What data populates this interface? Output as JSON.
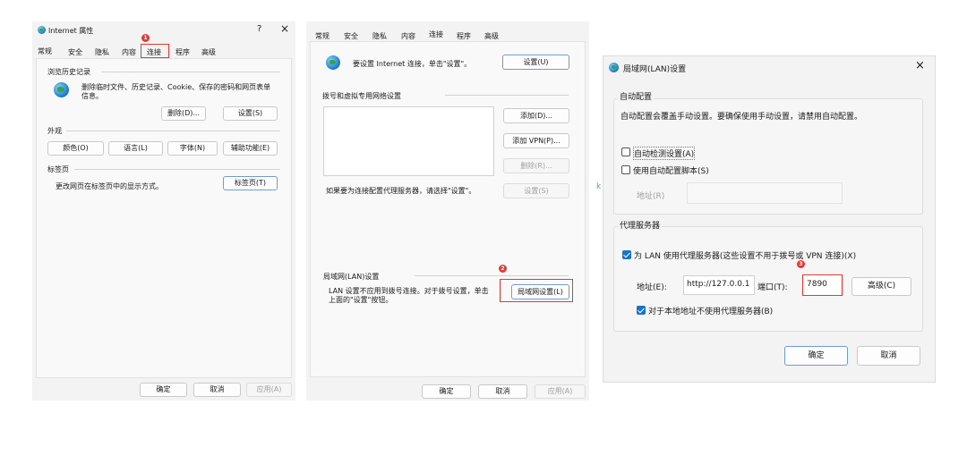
{
  "d1": {
    "title": "Internet 属性",
    "help": "?",
    "close": "×",
    "tabs": [
      "常规",
      "安全",
      "隐私",
      "内容",
      "连接",
      "程序",
      "高级"
    ],
    "history": {
      "heading": "浏览历史记录",
      "desc": "删除临时文件、历史记录、Cookie、保存的密码和网页表单信息。",
      "delete_btn": "删除(D)...",
      "settings_btn": "设置(S)"
    },
    "appearance": {
      "heading": "外观",
      "buttons": [
        "颜色(O)",
        "语言(L)",
        "字体(N)",
        "辅助功能(E)"
      ]
    },
    "tabs_section": {
      "heading": "标签页",
      "desc": "更改网页在标签页中的显示方式。",
      "btn": "标签页(T)"
    },
    "ok": "确定",
    "cancel": "取消",
    "apply": "应用(A)",
    "badge": "1"
  },
  "d2": {
    "tabs": [
      "常规",
      "安全",
      "隐私",
      "内容",
      "连接",
      "程序",
      "高级"
    ],
    "setup_text": "要设置 Internet 连接，单击\"设置\"。",
    "setup_btn": "设置(U)",
    "dialup_heading": "拨号和虚拟专用网络设置",
    "add_btn": "添加(D)...",
    "add_vpn_btn": "添加 VPN(P)...",
    "remove_btn": "删除(R)...",
    "proxy_text": "如果要为连接配置代理服务器，请选择\"设置\"。",
    "settings_btn": "设置(S)",
    "lan_heading": "局域网(LAN)设置",
    "lan_desc": "LAN 设置不应用到拨号连接。对于拨号设置，单击上面的\"设置\"按钮。",
    "lan_btn": "局域网设置(L)",
    "ok": "确定",
    "cancel": "取消",
    "apply": "应用(A)",
    "badge": "2"
  },
  "d3": {
    "title": "局域网(LAN)设置",
    "close": "×",
    "auto_heading": "自动配置",
    "auto_desc": "自动配置会覆盖手动设置。要确保使用手动设置，请禁用自动配置。",
    "auto_detect": "自动检测设置(A)",
    "auto_detect_checked": false,
    "use_script": "使用自动配置脚本(S)",
    "use_script_checked": false,
    "addr_label": "地址(R)",
    "proxy_heading": "代理服务器",
    "use_proxy": "为 LAN 使用代理服务器(这些设置不用于拨号或 VPN 连接)(X)",
    "use_proxy_checked": true,
    "address_label": "地址(E):",
    "address_value": "http://127.0.0.1",
    "port_label": "端口(T):",
    "port_value": "7890",
    "advanced_btn": "高级(C)",
    "bypass": "对于本地地址不使用代理服务器(B)",
    "bypass_checked": true,
    "ok": "确定",
    "cancel": "取消",
    "badge": "3"
  },
  "stray_char": "k"
}
